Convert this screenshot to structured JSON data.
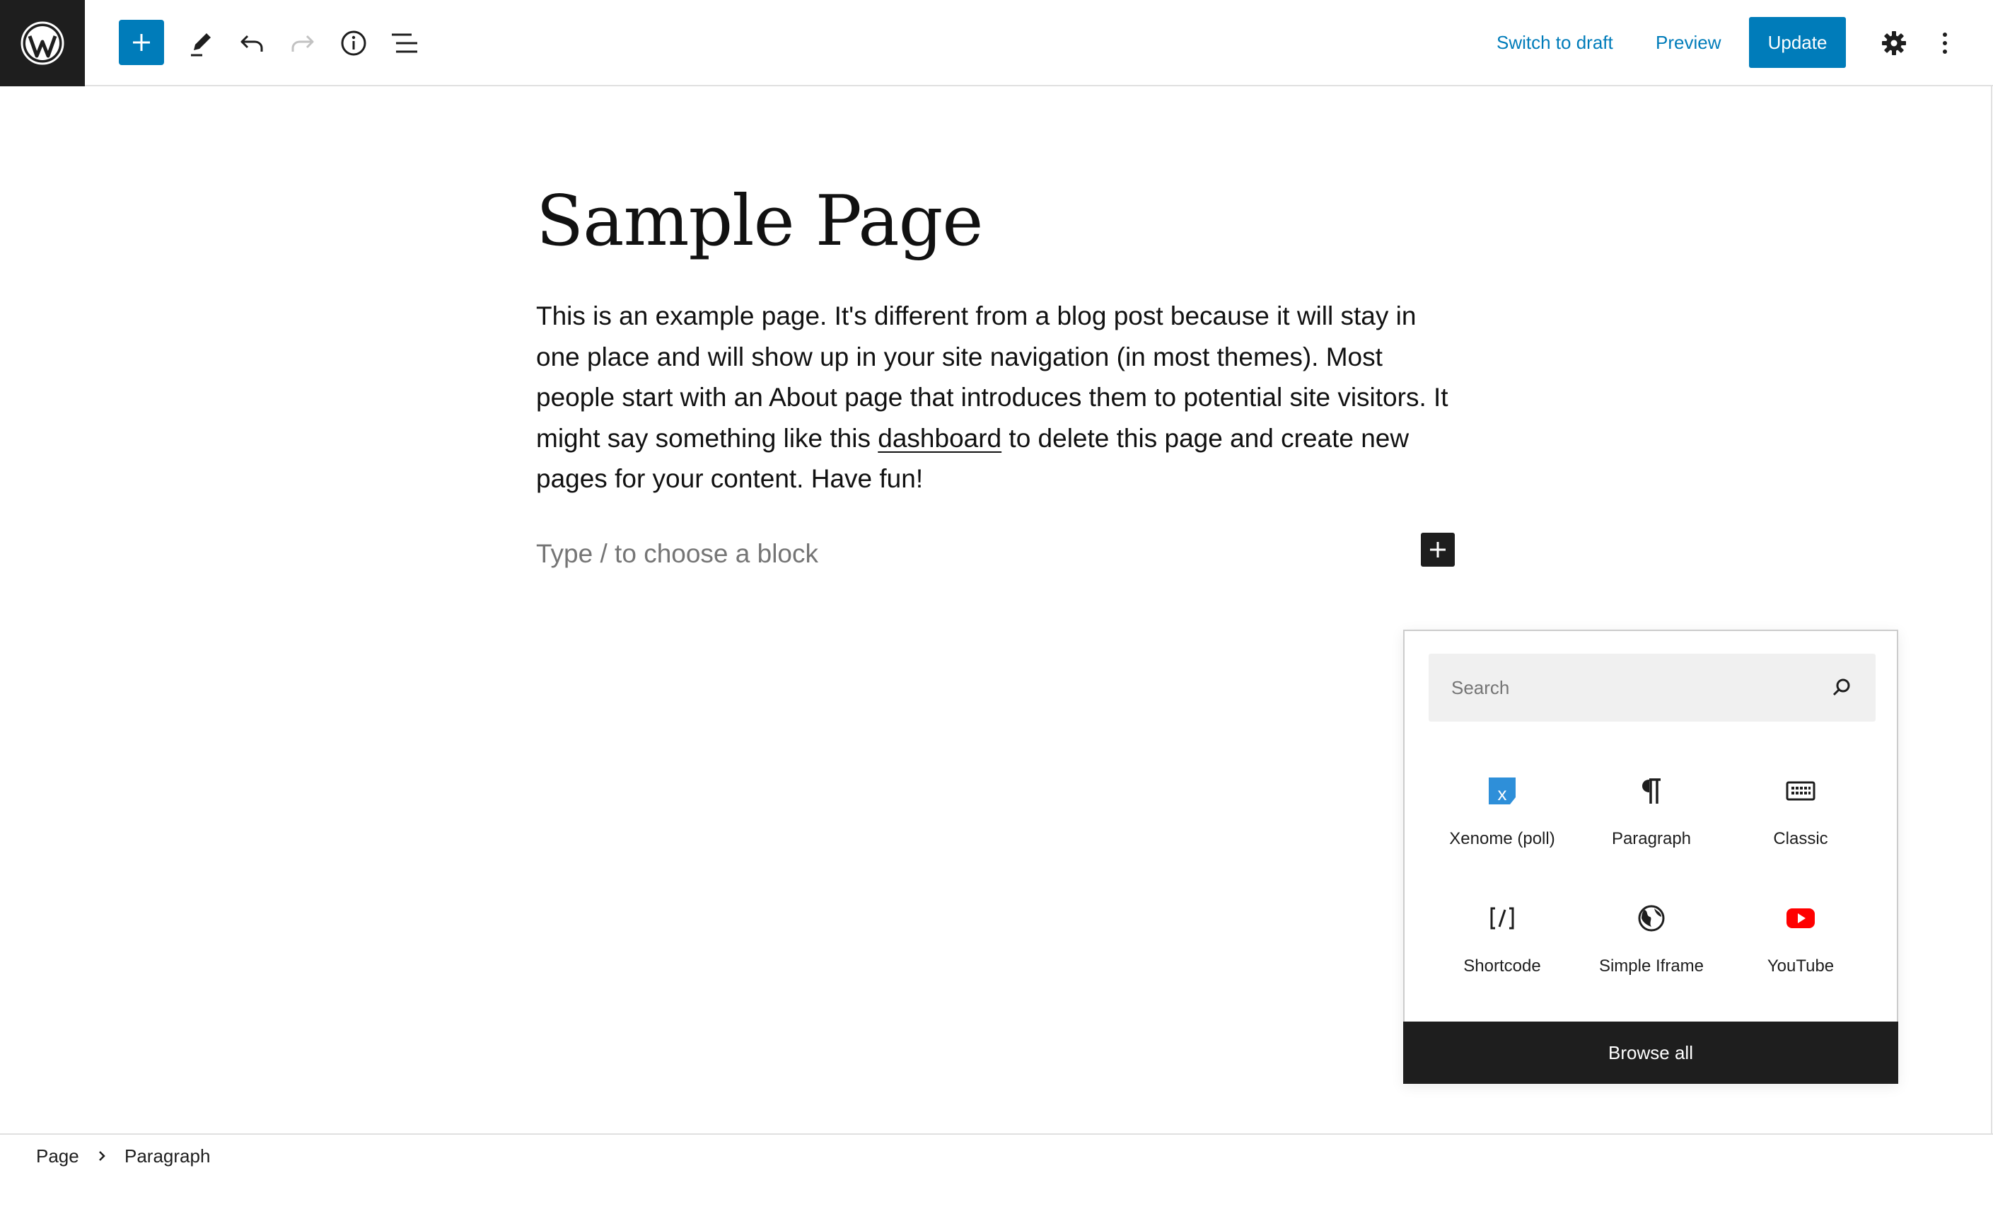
{
  "toolbar": {
    "switch_to_draft": "Switch to draft",
    "preview": "Preview",
    "update": "Update"
  },
  "content": {
    "title": "Sample Page",
    "paragraph_before_link": "This is an example page. It's different from a blog post because it will stay in one place and will show up in your site navigation (in most themes). Most people start with an About page that introduces them to potential site visitors. It might say something like this ",
    "paragraph_link": "dashboard",
    "paragraph_after_link": " to delete this page and create new pages for your content. Have fun!",
    "block_placeholder": "Type / to choose a block"
  },
  "inserter": {
    "search_placeholder": "Search",
    "blocks": [
      {
        "label": "Xenome (poll)",
        "icon": "xenome-poll-icon"
      },
      {
        "label": "Paragraph",
        "icon": "paragraph-icon"
      },
      {
        "label": "Classic",
        "icon": "keyboard-icon"
      },
      {
        "label": "Shortcode",
        "icon": "shortcode-icon"
      },
      {
        "label": "Simple Iframe",
        "icon": "globe-icon"
      },
      {
        "label": "YouTube",
        "icon": "youtube-icon"
      }
    ],
    "browse_all": "Browse all"
  },
  "breadcrumb": {
    "items": [
      "Page",
      "Paragraph"
    ]
  },
  "colors": {
    "accent": "#007cba",
    "dark": "#1e1e1e",
    "muted": "#757575",
    "youtube_red": "#ff0000",
    "xenome_blue": "#2e8fd9"
  }
}
